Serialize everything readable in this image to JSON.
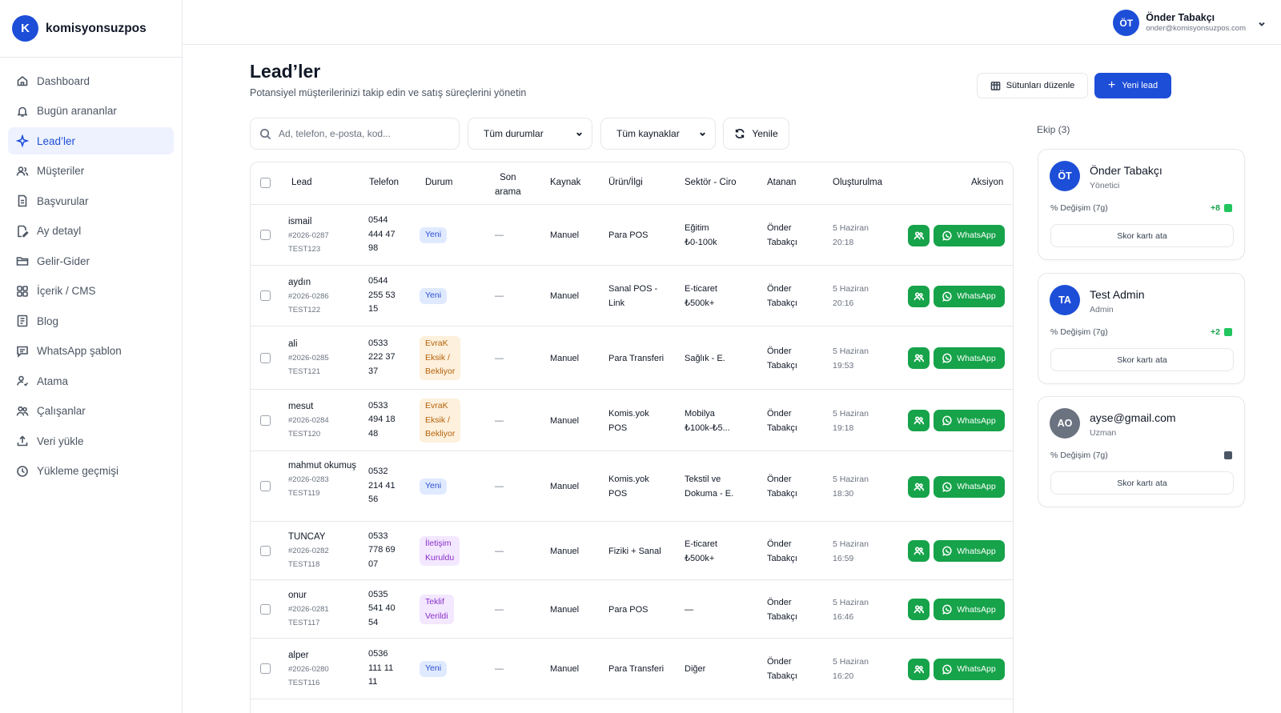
{
  "app": {
    "logo_letter": "K",
    "name": "komisyonsuzpos"
  },
  "sidebar": {
    "items": [
      {
        "label": "Dashboard",
        "icon": "home-icon"
      },
      {
        "label": "Bugün arananlar",
        "icon": "bell-icon"
      },
      {
        "label": "Lead’ler",
        "icon": "sparkle-icon",
        "active": true
      },
      {
        "label": "Müşteriler",
        "icon": "users-icon"
      },
      {
        "label": "Başvurular",
        "icon": "document-icon"
      },
      {
        "label": "Ay detayl",
        "icon": "edit-icon"
      },
      {
        "label": "Gelir-Gider",
        "icon": "folder-icon"
      },
      {
        "label": "İçerik / CMS",
        "icon": "grid-icon"
      },
      {
        "label": "Blog",
        "icon": "book-icon"
      },
      {
        "label": "WhatsApp şablon",
        "icon": "message-icon"
      },
      {
        "label": "Atama",
        "icon": "user-assign-icon"
      },
      {
        "label": "Çalışanlar",
        "icon": "team-icon"
      },
      {
        "label": "Veri yükle",
        "icon": "upload-icon"
      },
      {
        "label": "Yükleme geçmişi",
        "icon": "clock-icon"
      }
    ]
  },
  "user": {
    "initials": "ÖT",
    "name": "Önder Tabakçı",
    "email": "onder@komisyonsuzpos.com"
  },
  "header": {
    "title": "Lead’ler",
    "subtitle": "Potansiyel müşterilerinizi takip edin ve satış süreçlerini yönetin",
    "columns_button": "Sütunları düzenle",
    "new_button": "Yeni lead"
  },
  "filters": {
    "search_placeholder": "Ad, telefon, e-posta, kod...",
    "status_select": "Tüm durumlar",
    "source_select": "Tüm kaynaklar",
    "refresh": "Yenile"
  },
  "table": {
    "headers": {
      "lead": "Lead",
      "phone": "Telefon",
      "status": "Durum",
      "last_call_1": "Son",
      "last_call_2": "arama",
      "source": "Kaynak",
      "product": "Ürün/İlgi",
      "sector": "Sektör - Ciro",
      "assignee": "Atanan",
      "created": "Oluşturulma",
      "action": "Aksiyon"
    },
    "whatsapp_label": "WhatsApp",
    "rows": [
      {
        "name": "ismail",
        "code": "#2026-0287",
        "ref": "TEST123",
        "phone": [
          "0544",
          "444 47",
          "98"
        ],
        "status": [
          "Yeni"
        ],
        "status_type": "new",
        "last_call": "—",
        "source": "Manuel",
        "product": [
          "Para POS"
        ],
        "sector": [
          "Eğitim",
          "₺0-100k"
        ],
        "assignee": [
          "Önder",
          "Tabakçı"
        ],
        "created": [
          "5 Haziran",
          "20:18"
        ]
      },
      {
        "name": "aydın",
        "code": "#2026-0286",
        "ref": "TEST122",
        "phone": [
          "0544",
          "255 53",
          "15"
        ],
        "status": [
          "Yeni"
        ],
        "status_type": "new",
        "last_call": "—",
        "source": "Manuel",
        "product": [
          "Sanal POS -",
          "Link"
        ],
        "sector": [
          "E-ticaret",
          "₺500k+"
        ],
        "assignee": [
          "Önder",
          "Tabakçı"
        ],
        "created": [
          "5 Haziran",
          "20:16"
        ]
      },
      {
        "name": "ali",
        "code": "#2026-0285",
        "ref": "TEST121",
        "phone": [
          "0533",
          "222 37",
          "37"
        ],
        "status": [
          "EvraK",
          "Eksik /",
          "Bekliyor"
        ],
        "status_type": "warn",
        "last_call": "—",
        "source": "Manuel",
        "product": [
          "Para Transferi"
        ],
        "sector": [
          "Sağlık - E."
        ],
        "assignee": [
          "Önder",
          "Tabakçı"
        ],
        "created": [
          "5 Haziran",
          "19:53"
        ]
      },
      {
        "name": "mesut",
        "code": "#2026-0284",
        "ref": "TEST120",
        "phone": [
          "0533",
          "494 18",
          "48"
        ],
        "status": [
          "EvraK",
          "Eksik /",
          "Bekliyor"
        ],
        "status_type": "warn",
        "last_call": "—",
        "source": "Manuel",
        "product": [
          "Komis.yok",
          "POS"
        ],
        "sector": [
          "Mobilya",
          "₺100k-₺5..."
        ],
        "assignee": [
          "Önder",
          "Tabakçı"
        ],
        "created": [
          "5 Haziran",
          "19:18"
        ]
      },
      {
        "name": "mahmut okumuş",
        "code": "#2026-0283",
        "ref": "TEST119",
        "phone": [
          "0532",
          "214 41",
          "56"
        ],
        "status": [
          "Yeni"
        ],
        "status_type": "new",
        "last_call": "—",
        "source": "Manuel",
        "product": [
          "Komis.yok",
          "POS"
        ],
        "sector": [
          "Tekstil ve",
          "Dokuma - E."
        ],
        "assignee": [
          "Önder",
          "Tabakçı"
        ],
        "created": [
          "5 Haziran",
          "18:30"
        ]
      },
      {
        "name": "TUNCAY",
        "code": "#2026-0282",
        "ref": "TEST118",
        "phone": [
          "0533",
          "778 69",
          "07"
        ],
        "status": [
          "İletişim",
          "Kuruldu"
        ],
        "status_type": "purple",
        "last_call": "—",
        "source": "Manuel",
        "product": [
          "Fiziki + Sanal"
        ],
        "sector": [
          "E-ticaret",
          "₺500k+"
        ],
        "assignee": [
          "Önder",
          "Tabakçı"
        ],
        "created": [
          "5 Haziran",
          "16:59"
        ]
      },
      {
        "name": "onur",
        "code": "#2026-0281",
        "ref": "TEST117",
        "phone": [
          "0535",
          "541 40",
          "54"
        ],
        "status": [
          "Teklif",
          "Verildi"
        ],
        "status_type": "purple",
        "last_call": "—",
        "source": "Manuel",
        "product": [
          "Para POS"
        ],
        "sector": [
          "—"
        ],
        "assignee": [
          "Önder",
          "Tabakçı"
        ],
        "created": [
          "5 Haziran",
          "16:46"
        ]
      },
      {
        "name": "alper",
        "code": "#2026-0280",
        "ref": "TEST116",
        "phone": [
          "0536",
          "111 11",
          "11"
        ],
        "status": [
          "Yeni"
        ],
        "status_type": "new",
        "last_call": "—",
        "source": "Manuel",
        "product": [
          "Para Transferi"
        ],
        "sector": [
          "Diğer"
        ],
        "assignee": [
          "Önder",
          "Tabakçı"
        ],
        "created": [
          "5 Haziran",
          "16:20"
        ]
      }
    ]
  },
  "team": {
    "title": "Ekip (3)",
    "change_label": "% Değişim (7g)",
    "score_button": "Skor kartı ata",
    "members": [
      {
        "initials": "ÖT",
        "name": "Önder Tabakçı",
        "role": "Yönetici",
        "delta": "+8",
        "avatar_color": "#1d4ed8"
      },
      {
        "initials": "TA",
        "name": "Test Admin",
        "role": "Admin",
        "delta": "+2",
        "avatar_color": "#1d4ed8"
      },
      {
        "initials": "AO",
        "name": "ayse@gmail.com",
        "role": "Uzman",
        "delta": "",
        "avatar_color": "#6b7280"
      }
    ]
  },
  "colors": {
    "accent": "#1d4ed8",
    "success": "#16a34a"
  }
}
